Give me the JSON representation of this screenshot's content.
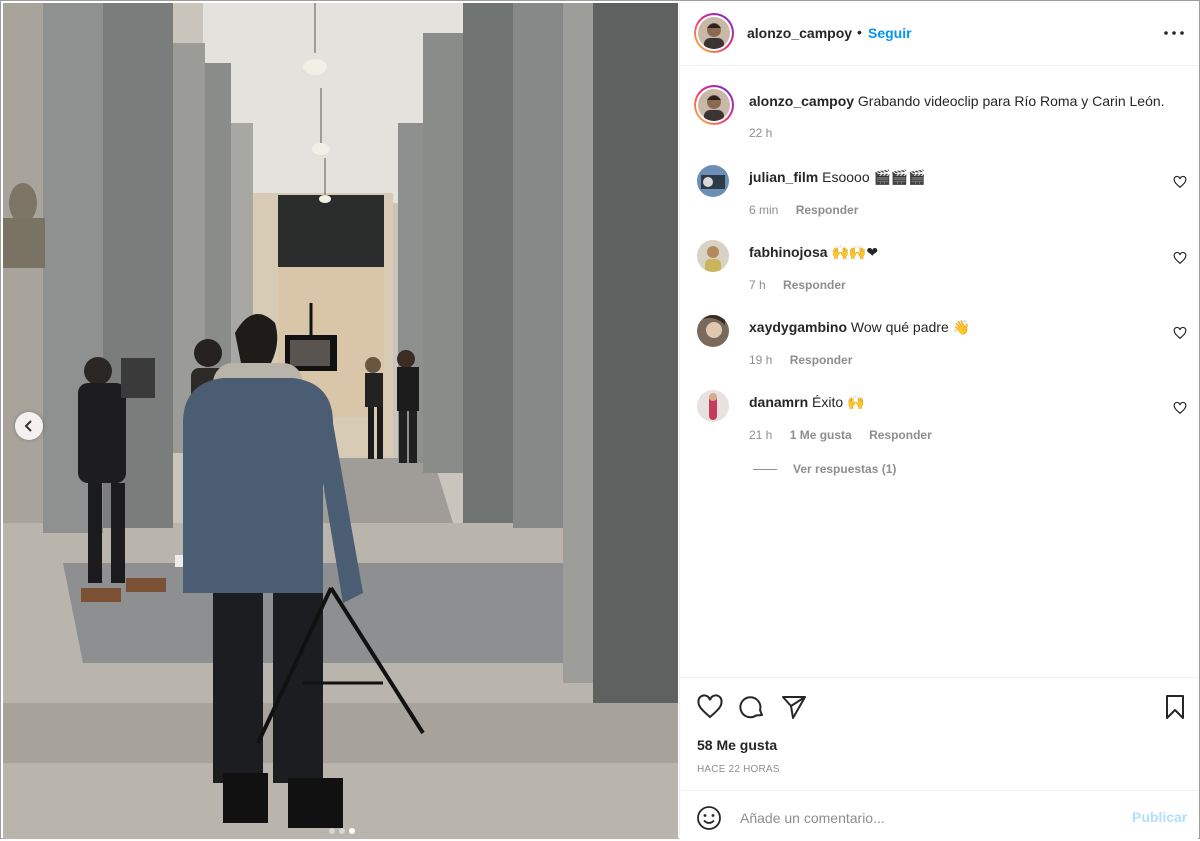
{
  "post": {
    "username": "alonzo_campoy",
    "separator": "•",
    "follow_label": "Seguir",
    "more_icon": "more-horizontal-icon"
  },
  "caption": {
    "username": "alonzo_campoy",
    "text": "Grabando videoclip para Río Roma y Carin León.",
    "time": "22 h"
  },
  "comments": [
    {
      "username": "julian_film",
      "text": "Esoooo 🎬🎬🎬",
      "time": "6 min",
      "likes": "",
      "reply_label": "Responder"
    },
    {
      "username": "fabhinojosa",
      "text": "🙌🙌❤",
      "time": "7 h",
      "likes": "",
      "reply_label": "Responder"
    },
    {
      "username": "xaydygambino",
      "text": "Wow qué padre 👋",
      "time": "19 h",
      "likes": "",
      "reply_label": "Responder"
    },
    {
      "username": "danamrn",
      "text": "Éxito 🙌",
      "time": "21 h",
      "likes": "1 Me gusta",
      "reply_label": "Responder"
    }
  ],
  "view_replies": "Ver respuestas (1)",
  "actions": {
    "like_icon": "heart-icon",
    "comment_icon": "comment-icon",
    "share_icon": "send-icon",
    "save_icon": "bookmark-icon"
  },
  "likes_count": "58 Me gusta",
  "posted_time": "HACE 22 HORAS",
  "comment_box": {
    "placeholder": "Añade un comentario...",
    "publish_label": "Publicar"
  },
  "carousel": {
    "total": 3,
    "active_index": 2
  },
  "colors": {
    "accent_blue": "#0095f6",
    "publish_disabled": "#b2dffc",
    "muted_text": "#8e8e8e",
    "primary_text": "#262626"
  }
}
